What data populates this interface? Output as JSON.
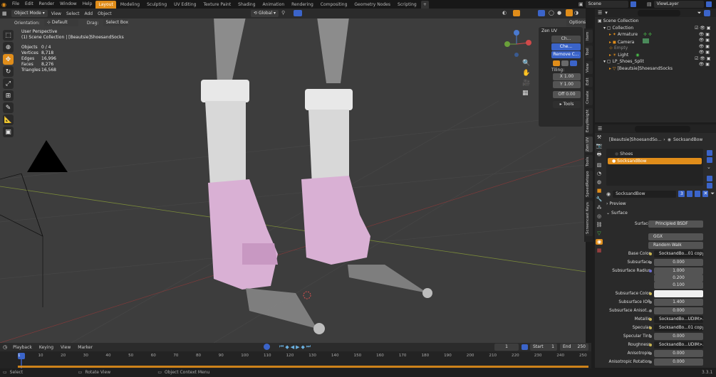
{
  "topbar": {
    "menus": [
      "File",
      "Edit",
      "Render",
      "Window",
      "Help"
    ],
    "workspaces": [
      "Layout",
      "Modeling",
      "Sculpting",
      "UV Editing",
      "Texture Paint",
      "Shading",
      "Animation",
      "Rendering",
      "Compositing",
      "Geometry Nodes",
      "Scripting"
    ],
    "active_workspace": "Layout",
    "add_tab": "+",
    "scene_label": "Scene",
    "view_layer_label": "ViewLayer"
  },
  "viewport": {
    "mode": "Object Mode",
    "menus": [
      "View",
      "Select",
      "Add",
      "Object"
    ],
    "transform_orientation": "Global",
    "orientation_label": "Orientation:",
    "orientation_value": "Default",
    "drag_label": "Drag:",
    "drag_value": "Select Box",
    "options_label": "Options",
    "perspective": "User Perspective",
    "collection_path": "(1) Scene Collection | [Beautsie]ShoesandSocks",
    "stats": [
      {
        "label": "Objects",
        "value": "0 / 4"
      },
      {
        "label": "Vertices",
        "value": "8,718"
      },
      {
        "label": "Edges",
        "value": "16,996"
      },
      {
        "label": "Faces",
        "value": "8,276"
      },
      {
        "label": "Triangles",
        "value": "16,568"
      }
    ]
  },
  "zen_uv": {
    "title": "Zen UV",
    "btn_ch": "Ch...",
    "btn_che": "Che...",
    "btn_remove": "Remove C...",
    "tiling_label": "Tiling:",
    "tiling_x_label": "X",
    "tiling_x": "1.00",
    "tiling_y_label": "Y",
    "tiling_y": "1.00",
    "offset_label": "Off",
    "offset": "0.00",
    "tools_label": "Tools"
  },
  "side_tabs": [
    "Item",
    "Tool",
    "View",
    "Edit",
    "Create",
    "EasyWeight",
    "Zen UV",
    "Tools",
    "SpeedRetopo",
    "Screencast Keys"
  ],
  "outliner": {
    "root": "Scene Collection",
    "items": [
      {
        "name": "Collection",
        "indent": 1
      },
      {
        "name": "Armature",
        "indent": 2
      },
      {
        "name": "Camera",
        "indent": 2
      },
      {
        "name": "Empty",
        "indent": 2
      },
      {
        "name": "Light",
        "indent": 2
      },
      {
        "name": "LP_Shoes_Split",
        "indent": 1
      },
      {
        "name": "[Beautsie]ShoesandSocks",
        "indent": 2
      }
    ]
  },
  "properties": {
    "breadcrumb_object": "[Beautsie]ShoesandSo...",
    "breadcrumb_material": "SocksandBow",
    "material_slots": [
      "Shoes",
      "SocksandBow"
    ],
    "material_name": "SocksandBow",
    "material_users": "3",
    "preview_label": "Preview",
    "surface_label": "Surface",
    "rows": [
      {
        "label": "Surface",
        "value": "Principled BSDF"
      },
      {
        "label": "",
        "value": "GGX"
      },
      {
        "label": "",
        "value": "Random Walk"
      },
      {
        "label": "Base Color",
        "value": "SocksandBo...01 copy.png"
      },
      {
        "label": "Subsurface",
        "value": "0.000"
      },
      {
        "label": "Subsurface Radius",
        "value": "1.000"
      },
      {
        "label": "",
        "value": "0.200"
      },
      {
        "label": "",
        "value": "0.100"
      },
      {
        "label": "Subsurface Color",
        "value": ""
      },
      {
        "label": "Subsurface IOR",
        "value": "1.400"
      },
      {
        "label": "Subsurface Anisot...",
        "value": "0.000"
      },
      {
        "label": "Metallic",
        "value": "SocksandBo...UDIM>.png"
      },
      {
        "label": "Specular",
        "value": "SocksandBo...01 copy.png"
      },
      {
        "label": "Specular Tint",
        "value": "0.000"
      },
      {
        "label": "Roughness",
        "value": "SocksandBo...UDIM>.png"
      },
      {
        "label": "Anisotropic",
        "value": "0.000"
      },
      {
        "label": "Anisotropic Rotation",
        "value": "0.000"
      }
    ]
  },
  "timeline": {
    "menus": [
      "Playback",
      "Keying",
      "View",
      "Marker"
    ],
    "current_frame": "1",
    "start_label": "Start",
    "start": "1",
    "end_label": "End",
    "end": "250",
    "ticks": [
      "1",
      "10",
      "20",
      "30",
      "40",
      "50",
      "60",
      "70",
      "80",
      "90",
      "100",
      "110",
      "120",
      "130",
      "140",
      "150",
      "160",
      "170",
      "180",
      "190",
      "200",
      "210",
      "220",
      "230",
      "240",
      "250"
    ]
  },
  "status": {
    "select": "Select",
    "rotate": "Rotate View",
    "context": "Object Context Menu",
    "version": "3.3.1"
  }
}
